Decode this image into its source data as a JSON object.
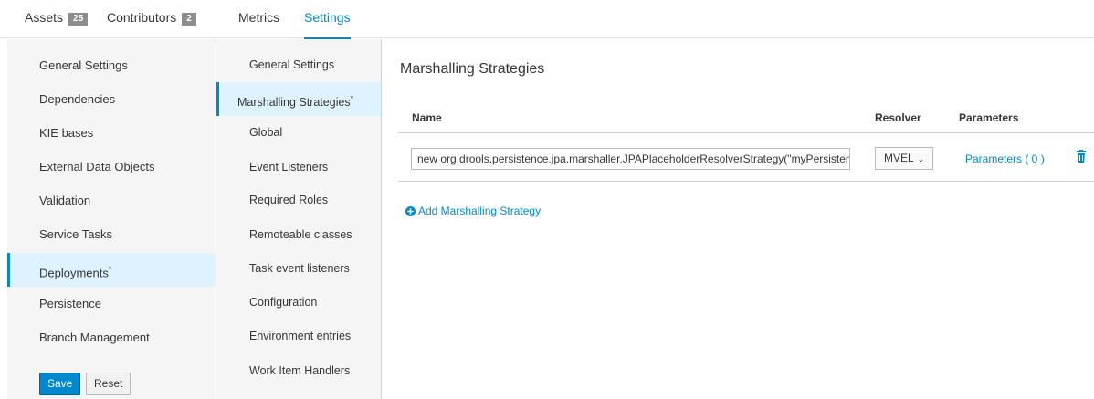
{
  "tabs": [
    {
      "label": "Assets",
      "badge": "25"
    },
    {
      "label": "Contributors",
      "badge": "2"
    },
    {
      "label": "Metrics",
      "badge": ""
    },
    {
      "label": "Settings",
      "badge": ""
    }
  ],
  "settings_nav": [
    {
      "label": "General Settings",
      "modified": ""
    },
    {
      "label": "Dependencies",
      "modified": ""
    },
    {
      "label": "KIE bases",
      "modified": ""
    },
    {
      "label": "External Data Objects",
      "modified": ""
    },
    {
      "label": "Validation",
      "modified": ""
    },
    {
      "label": "Service Tasks",
      "modified": ""
    },
    {
      "label": "Deployments",
      "modified": "*"
    },
    {
      "label": "Persistence",
      "modified": ""
    },
    {
      "label": "Branch Management",
      "modified": ""
    }
  ],
  "deployment_nav": [
    {
      "label": "General Settings",
      "modified": ""
    },
    {
      "label": "Marshalling Strategies",
      "modified": "*"
    },
    {
      "label": "Global",
      "modified": ""
    },
    {
      "label": "Event Listeners",
      "modified": ""
    },
    {
      "label": "Required Roles",
      "modified": ""
    },
    {
      "label": "Remoteable classes",
      "modified": ""
    },
    {
      "label": "Task event listeners",
      "modified": ""
    },
    {
      "label": "Configuration",
      "modified": ""
    },
    {
      "label": "Environment entries",
      "modified": ""
    },
    {
      "label": "Work Item Handlers",
      "modified": ""
    }
  ],
  "buttons": {
    "save": "Save",
    "reset": "Reset"
  },
  "main": {
    "title": "Marshalling Strategies",
    "columns": {
      "name": "Name",
      "resolver": "Resolver",
      "parameters": "Parameters"
    },
    "rows": [
      {
        "name": "new org.drools.persistence.jpa.marshaller.JPAPlaceholderResolverStrategy(\"myPersistenc",
        "resolver": "MVEL",
        "parameters": "Parameters ( 0 )"
      }
    ],
    "add_label": "Add Marshalling Strategy"
  },
  "colors": {
    "accent": "#0088ce",
    "active_bg": "#def3ff",
    "panel_bg": "#f5f5f5"
  },
  "icons": {
    "add": "plus-circle-icon",
    "delete": "trash-icon",
    "dropdown": "chevron-down-icon"
  }
}
